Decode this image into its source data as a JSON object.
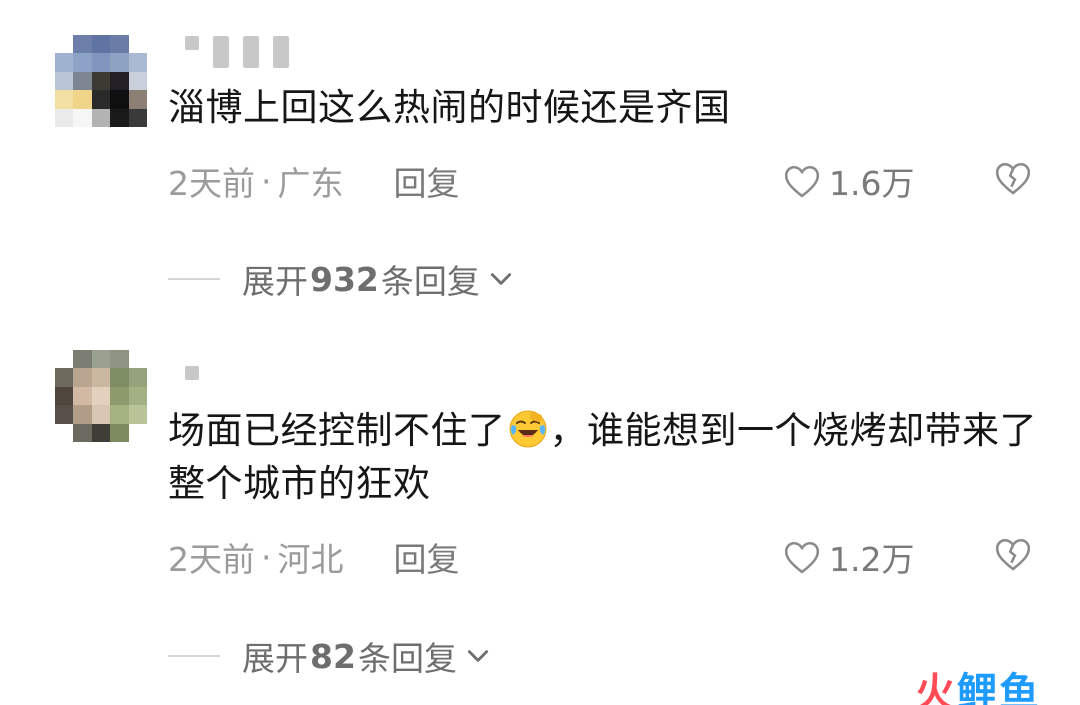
{
  "comments": [
    {
      "text": "淄博上回这么热闹的时候还是齐国",
      "text_after_emoji": "",
      "time": "2天前",
      "separator": "·",
      "location": "广东",
      "reply_label": "回复",
      "likes": "1.6万",
      "expand": {
        "prefix": "展开",
        "count": "932",
        "suffix": "条回复"
      }
    },
    {
      "text": "场面已经控制不住了",
      "emoji": "laughing-crying-emoji",
      "text_after_emoji": "，谁能想到一个烧烤却带来了整个城市的狂欢",
      "time": "2天前",
      "separator": "·",
      "location": "河北",
      "reply_label": "回复",
      "likes": "1.2万",
      "expand": {
        "prefix": "展开",
        "count": "82",
        "suffix": "条回复"
      }
    }
  ],
  "watermark": {
    "part1": "火",
    "part2": "鲤鱼"
  },
  "colors": {
    "text": "#161616",
    "meta": "#9b9b9b",
    "icon": "#7a7a7a",
    "watermark_red": "#ff4b55",
    "watermark_blue": "#1e9bff"
  }
}
